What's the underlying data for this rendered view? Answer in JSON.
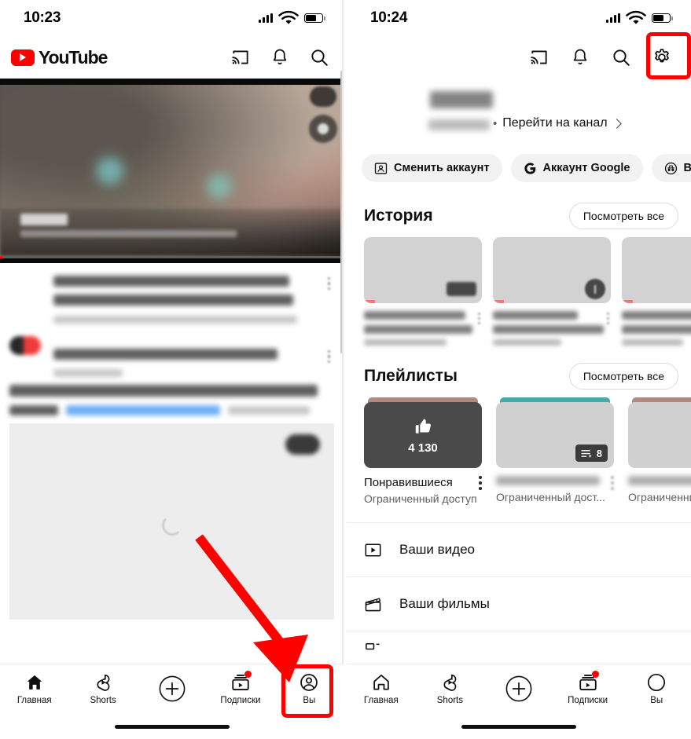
{
  "left": {
    "status": {
      "time": "10:23",
      "signal_icon": "cellular-bars-icon",
      "wifi_icon": "wifi-icon",
      "battery_icon": "battery-icon"
    },
    "appbar": {
      "brand": "YouTube",
      "cast_icon": "cast-icon",
      "bell_icon": "notifications-bell-icon",
      "search_icon": "search-icon"
    },
    "nav": {
      "items": [
        {
          "label": "Главная",
          "icon": "home-icon",
          "active": true
        },
        {
          "label": "Shorts",
          "icon": "shorts-icon",
          "active": false
        },
        {
          "label": "",
          "icon": "create-plus-icon",
          "active": false
        },
        {
          "label": "Подписки",
          "icon": "subscriptions-icon",
          "active": false,
          "badge": true
        },
        {
          "label": "Вы",
          "icon": "account-avatar-icon",
          "active": false
        }
      ]
    }
  },
  "right": {
    "status": {
      "time": "10:24",
      "signal_icon": "cellular-bars-icon",
      "wifi_icon": "wifi-icon",
      "battery_icon": "battery-icon"
    },
    "appbar": {
      "cast_icon": "cast-icon",
      "bell_icon": "notifications-bell-icon",
      "search_icon": "search-icon",
      "settings_icon": "gear-settings-icon"
    },
    "account": {
      "name_redacted": "",
      "handle_redacted": "",
      "separator": "•",
      "go_to_channel": "Перейти на канал",
      "chevron_icon": "chevron-right-icon",
      "chips": [
        {
          "label": "Сменить аккаунт",
          "icon": "switch-account-icon"
        },
        {
          "label": "Аккаунт Google",
          "icon": "google-g-icon"
        },
        {
          "label": "Включить р",
          "icon": "incognito-icon"
        }
      ]
    },
    "history": {
      "title": "История",
      "see_all": "Посмотреть все",
      "cards": [
        {
          "badge_kind": "duration",
          "title_redacted": "",
          "meta_redacted": ""
        },
        {
          "badge_kind": "shorts",
          "title_redacted": "",
          "meta_redacted": ""
        },
        {
          "badge_kind": "none",
          "title_redacted": "",
          "meta_redacted": ""
        }
      ]
    },
    "playlists": {
      "title": "Плейлисты",
      "see_all": "Посмотреть все",
      "cards": [
        {
          "thumb_icon": "thumbs-up-icon",
          "count": "4 130",
          "title": "Понравившиеся",
          "subtitle": "Ограниченный доступ",
          "style": "dark",
          "strip_color": "#b08a80"
        },
        {
          "badge_icon": "playlist-queue-icon",
          "badge_count": "8",
          "title_redacted": "",
          "subtitle": "Ограниченный дост...",
          "style": "grey",
          "strip_color": "#4aa7a8"
        },
        {
          "title_redacted": "",
          "subtitle": "Ограниченнь",
          "style": "grey",
          "strip_color": "#b08a80"
        }
      ]
    },
    "menu": [
      {
        "label": "Ваши видео",
        "icon": "video-play-box-icon"
      },
      {
        "label": "Ваши фильмы",
        "icon": "movie-clapperboard-icon"
      }
    ],
    "nav": {
      "items": [
        {
          "label": "Главная",
          "icon": "home-outline-icon",
          "active": false
        },
        {
          "label": "Shorts",
          "icon": "shorts-icon",
          "active": false
        },
        {
          "label": "",
          "icon": "create-plus-icon",
          "active": false
        },
        {
          "label": "Подписки",
          "icon": "subscriptions-icon",
          "active": false,
          "badge": true
        },
        {
          "label": "Вы",
          "icon": "account-circle-icon",
          "active": false
        }
      ]
    }
  },
  "annotations": {
    "highlight_color": "#ff0000",
    "boxes": [
      {
        "name": "you-tab-highlight",
        "target": "Вы"
      },
      {
        "name": "settings-gear-highlight",
        "target": "gear-settings-icon"
      }
    ],
    "arrow": {
      "name": "pointer-arrow",
      "points_to": "Вы"
    }
  }
}
